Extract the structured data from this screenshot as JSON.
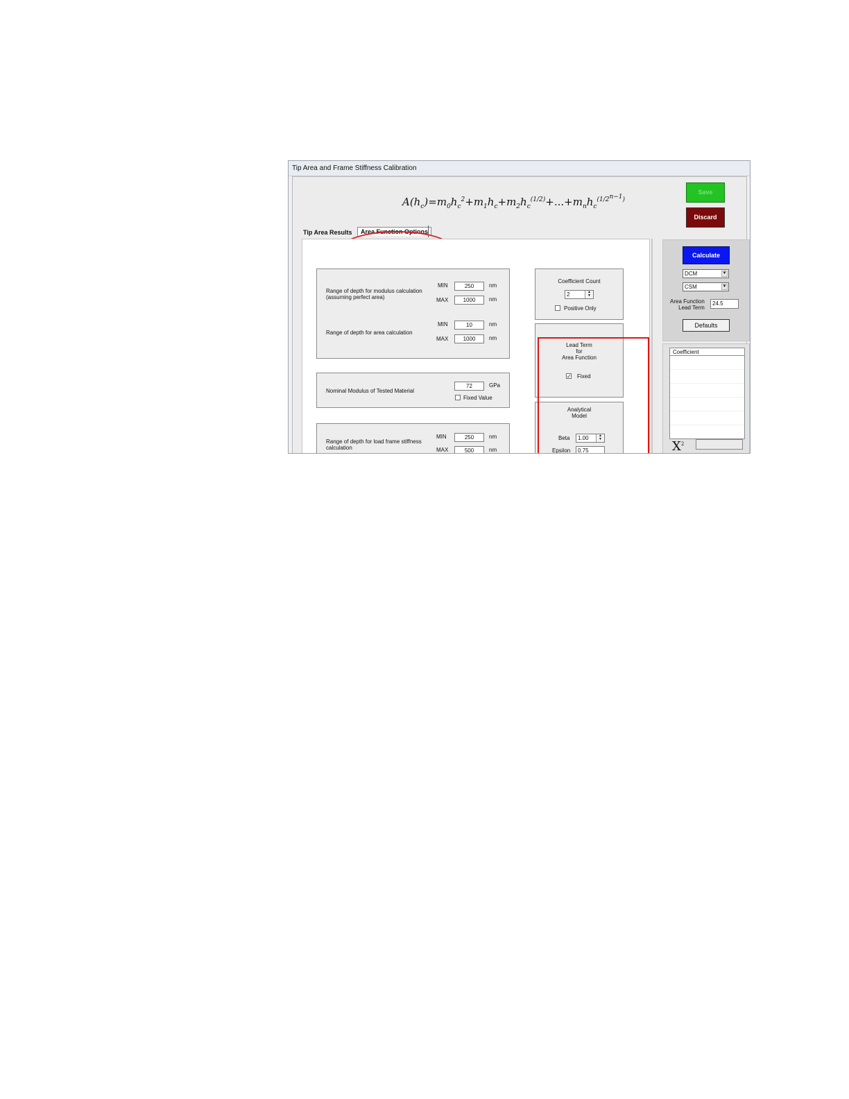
{
  "window": {
    "title": "Tip Area and Frame Stiffness Calibration"
  },
  "header": {
    "save_label": "Save",
    "discard_label": "Discard"
  },
  "tabs": [
    {
      "label": "Tip Area Results"
    },
    {
      "label": "Area Function Options"
    }
  ],
  "depth_group": {
    "modulus_label": "Range of depth for modulus calculation\n(assuming perfect area)",
    "area_label": "Range of depth for area calculation",
    "min_label": "MIN",
    "max_label": "MAX",
    "unit": "nm",
    "modulus_min": "250",
    "modulus_max": "1000",
    "area_min": "10",
    "area_max": "1000"
  },
  "modulus_group": {
    "label": "Nominal Modulus of Tested Material",
    "value": "72",
    "unit": "GPa",
    "fixed_label": "Fixed Value"
  },
  "frame_group": {
    "label": "Range of depth for load frame stiffness\ncalculation",
    "min_label": "MIN",
    "max_label": "MAX",
    "unit": "nm",
    "min_value": "250",
    "max_value": "500"
  },
  "coefficient_group": {
    "title": "Coefficient Count",
    "count": "2",
    "positive_only_label": "Positive Only"
  },
  "lead_term_group": {
    "title": "Lead Term\nfor\nArea Function",
    "fixed_label": "Fixed",
    "fixed_checked": true,
    "check_mark": "✓"
  },
  "analytical_group": {
    "title": "Analytical\nModel",
    "beta_label": "Beta",
    "beta_value": "1.00",
    "epsilon_label": "Epsilon",
    "epsilon_value": "0.75"
  },
  "right_panel": {
    "calculate_label": "Calculate",
    "select1": "DCM",
    "select2": "CSM",
    "lead_term_label": "Area Function\nLead Term",
    "lead_term_value": "24.5",
    "defaults_label": "Defaults"
  },
  "coef_list": {
    "header": "Coefficient",
    "chi_label": "X"
  },
  "colors": {
    "save": "#22c322",
    "discard": "#7c0a0a",
    "calculate": "#0a17f2",
    "annotation": "#e01515"
  }
}
